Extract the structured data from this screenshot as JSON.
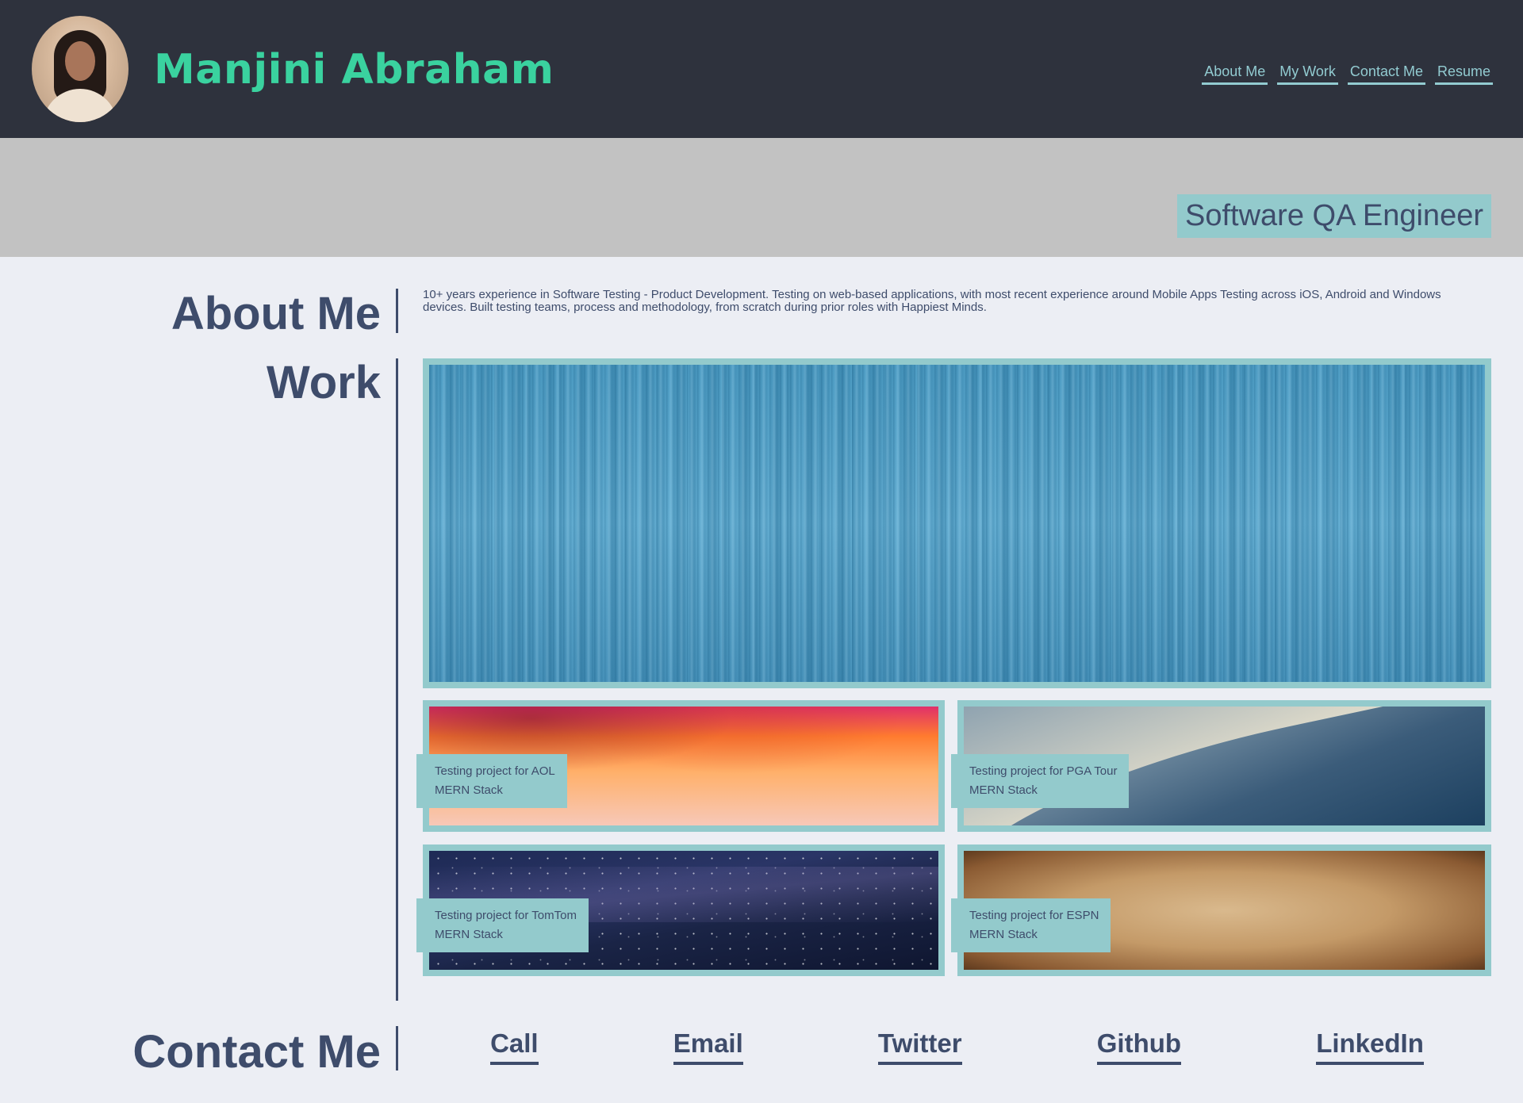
{
  "header": {
    "name": "Manjini Abraham",
    "nav": [
      {
        "label": "About Me"
      },
      {
        "label": "My Work"
      },
      {
        "label": "Contact Me"
      },
      {
        "label": "Resume"
      }
    ]
  },
  "banner": {
    "role": "Software QA Engineer"
  },
  "about": {
    "heading": "About Me",
    "text": "10+ years experience in Software Testing - Product Development. Testing on web-based applications, with most recent experience around Mobile Apps Testing across iOS, Android and Windows devices. Built testing teams, process and methodology, from scratch during prior roles with Happiest Minds."
  },
  "work": {
    "heading": "Work",
    "projects": [
      {
        "title": "Testing project for AOL",
        "stack": "MERN Stack"
      },
      {
        "title": "Testing project for PGA Tour",
        "stack": "MERN Stack"
      },
      {
        "title": "Testing project for TomTom",
        "stack": "MERN Stack"
      },
      {
        "title": "Testing project for ESPN",
        "stack": "MERN Stack"
      }
    ]
  },
  "contact": {
    "heading": "Contact Me",
    "links": [
      {
        "label": "Call"
      },
      {
        "label": "Email"
      },
      {
        "label": "Twitter"
      },
      {
        "label": "Github"
      },
      {
        "label": "LinkedIn"
      }
    ]
  },
  "colors": {
    "header_bg": "#2e323d",
    "accent_green": "#3ad29f",
    "accent_teal": "#93cacc",
    "text_navy": "#3e4c6b",
    "banner_gray": "#c2c2c2",
    "page_bg": "#eceef4"
  }
}
